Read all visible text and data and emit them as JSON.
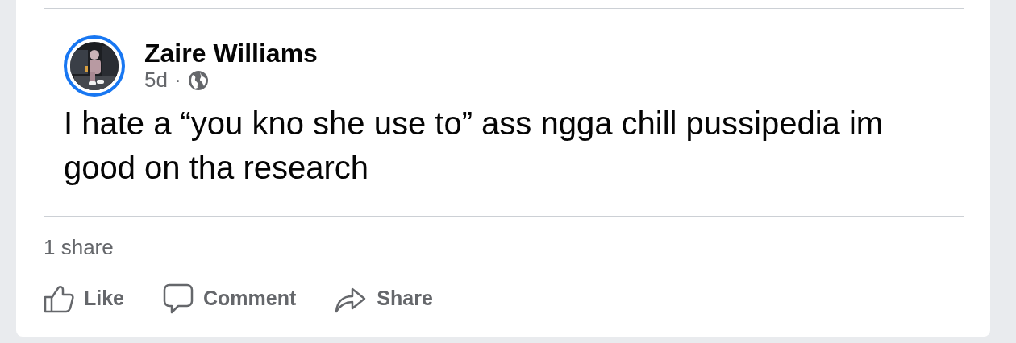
{
  "shared_post": {
    "author": "Zaire Williams",
    "time": "5d",
    "separator": "·",
    "text": "I hate a “you kno she use to” ass ngga chill pussipedia im good on tha research",
    "avatar": {
      "kind": "picture",
      "story_ring": true
    }
  },
  "share_count": "1 share",
  "actions": [
    {
      "kind": "like",
      "label": "Like"
    },
    {
      "kind": "comment",
      "label": "Comment"
    },
    {
      "kind": "share",
      "label": "Share"
    }
  ]
}
